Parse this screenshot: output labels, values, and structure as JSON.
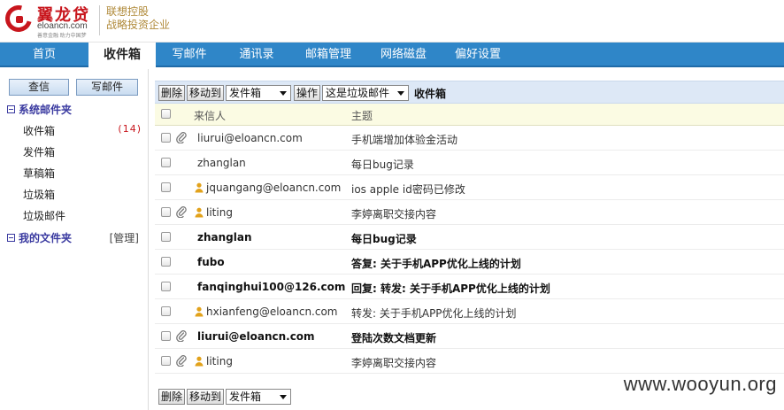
{
  "header": {
    "logo_name": "翼龙贷",
    "logo_domain": "eloancn.com",
    "logo_slogan": "善意金融 助力中国梦",
    "tagline_line1": "联想控股",
    "tagline_line2": "战略投资企业"
  },
  "nav": {
    "items": [
      "首页",
      "收件箱",
      "写邮件",
      "通讯录",
      "邮箱管理",
      "网络磁盘",
      "偏好设置"
    ],
    "active_index": 1
  },
  "sidebar": {
    "check_mail_label": "查信",
    "compose_label": "写邮件",
    "system_group_label": "系统邮件夹",
    "folders": [
      {
        "name": "收件箱",
        "count": "(14)"
      },
      {
        "name": "发件箱"
      },
      {
        "name": "草稿箱"
      },
      {
        "name": "垃圾箱"
      },
      {
        "name": "垃圾邮件"
      }
    ],
    "my_group_label": "我的文件夹",
    "manage_label": "[管理]"
  },
  "toolbar": {
    "delete_label": "删除",
    "move_to_label": "移动到",
    "move_target_selected": "发件箱",
    "operate_label": "操作",
    "operation_selected": "这是垃圾邮件",
    "title": "收件箱"
  },
  "table": {
    "col_sender": "来信人",
    "col_subject": "主题",
    "rows": [
      {
        "sender": "liurui@eloancn.com",
        "subject": "手机端增加体验金活动",
        "unread": false,
        "attachment": true,
        "contact": false
      },
      {
        "sender": "zhanglan",
        "subject": "每日bug记录",
        "unread": false,
        "attachment": false,
        "contact": false
      },
      {
        "sender": "jquangang@eloancn.com",
        "subject": "ios apple id密码已修改",
        "unread": false,
        "attachment": false,
        "contact": true
      },
      {
        "sender": "liting",
        "subject": "李婷离职交接内容",
        "unread": false,
        "attachment": true,
        "contact": true
      },
      {
        "sender": "zhanglan",
        "subject": "每日bug记录",
        "unread": true,
        "attachment": false,
        "contact": false
      },
      {
        "sender": "fubo",
        "subject": "答复: 关于手机APP优化上线的计划",
        "unread": true,
        "attachment": false,
        "contact": false
      },
      {
        "sender": "fanqinghui100@126.com",
        "subject": "回复: 转发: 关于手机APP优化上线的计划",
        "unread": true,
        "attachment": false,
        "contact": false
      },
      {
        "sender": "hxianfeng@eloancn.com",
        "subject": "转发: 关于手机APP优化上线的计划",
        "unread": false,
        "attachment": false,
        "contact": true
      },
      {
        "sender": "liurui@eloancn.com",
        "subject": "登陆次数文档更新",
        "unread": true,
        "attachment": true,
        "contact": false
      },
      {
        "sender": "liting",
        "subject": "李婷离职交接内容",
        "unread": false,
        "attachment": true,
        "contact": true
      }
    ]
  },
  "bottom_toolbar": {
    "delete_label": "删除",
    "move_to_label": "移动到",
    "move_target_selected": "发件箱"
  },
  "watermark": "www.wooyun.org",
  "colors": {
    "nav_bg": "#2f86c8",
    "brand_red": "#c8161d",
    "folder_link": "#3a3aa0",
    "toolbar_bg": "#dde8f6",
    "table_head_bg": "#fbfbe3"
  },
  "icons": {
    "attachment": "paperclip-icon",
    "contact": "contact-person-icon",
    "group_toggle": "collapse-minus-icon"
  }
}
